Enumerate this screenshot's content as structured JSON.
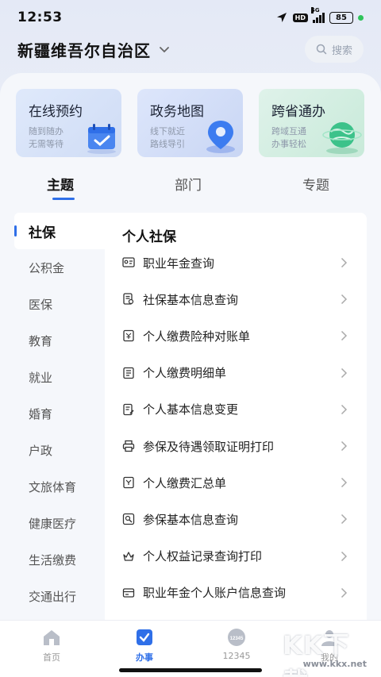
{
  "status_bar": {
    "time": "12:53",
    "hd": "HD",
    "network": "5G",
    "battery": "85"
  },
  "header": {
    "region": "新疆维吾尔自治区",
    "search_placeholder": "搜索"
  },
  "cards": [
    {
      "title": "在线预约",
      "sub1": "随到随办",
      "sub2": "无需等待"
    },
    {
      "title": "政务地图",
      "sub1": "线下就近",
      "sub2": "路线导引"
    },
    {
      "title": "跨省通办",
      "sub1": "跨域互通",
      "sub2": "办事轻松"
    }
  ],
  "tabs": [
    "主题",
    "部门",
    "专题"
  ],
  "sidebar": [
    "社保",
    "公积金",
    "医保",
    "教育",
    "就业",
    "婚育",
    "户政",
    "文旅体育",
    "健康医疗",
    "生活缴费",
    "交通出行"
  ],
  "content": {
    "section_title": "个人社保",
    "items": [
      "职业年金查询",
      "社保基本信息查询",
      "个人缴费险种对账单",
      "个人缴费明细单",
      "个人基本信息变更",
      "参保及待遇领取证明打印",
      "个人缴费汇总单",
      "参保基本信息查询",
      "个人权益记录查询打印",
      "职业年金个人账户信息查询"
    ]
  },
  "bottom_nav": [
    {
      "label": "首页",
      "icon": "home-icon"
    },
    {
      "label": "办事",
      "icon": "tasks-icon"
    },
    {
      "label": "12345",
      "icon": "hotline-icon"
    },
    {
      "label": "我的",
      "icon": "profile-icon"
    }
  ],
  "watermark": {
    "text": "KK下载",
    "url": "www.kkx.net"
  },
  "colors": {
    "accent": "#2f6fe8"
  }
}
